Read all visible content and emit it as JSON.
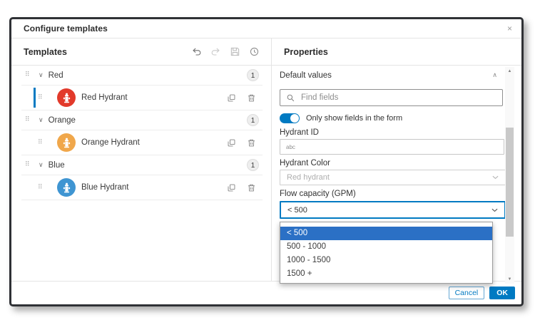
{
  "dialog": {
    "title": "Configure templates"
  },
  "icons": {
    "close": "×",
    "drag_handle": "⠿",
    "chevron_down": "∨",
    "chevron_up": "∧",
    "scroll_up": "▲",
    "scroll_down": "▼"
  },
  "templates": {
    "header": "Templates",
    "groups": [
      {
        "label": "Red",
        "count": "1",
        "item": {
          "label": "Red Hydrant",
          "color": "#e23a2b",
          "selected": true
        }
      },
      {
        "label": "Orange",
        "count": "1",
        "item": {
          "label": "Orange Hydrant",
          "color": "#f0a74b",
          "selected": false
        }
      },
      {
        "label": "Blue",
        "count": "1",
        "item": {
          "label": "Blue Hydrant",
          "color": "#3f95d2",
          "selected": false
        }
      }
    ]
  },
  "properties": {
    "header": "Properties",
    "section_title": "Default values",
    "search_placeholder": "Find fields",
    "toggle_label": "Only show fields in the form",
    "toggle_on": true,
    "fields": {
      "hydrant_id": {
        "label": "Hydrant ID",
        "value": "abc"
      },
      "hydrant_color": {
        "label": "Hydrant Color",
        "value": "Red hydrant",
        "disabled": true
      },
      "flow_capacity": {
        "label": "Flow capacity (GPM)",
        "value": "< 500"
      }
    },
    "dropdown": {
      "options": [
        "< 500",
        "500 - 1000",
        "1000 - 1500",
        "1500 +"
      ],
      "selected": "< 500"
    }
  },
  "footer": {
    "cancel_label": "Cancel",
    "ok_label": "OK"
  },
  "colors": {
    "accent": "#007ac2",
    "dropdown_selection": "#2b70c5"
  }
}
